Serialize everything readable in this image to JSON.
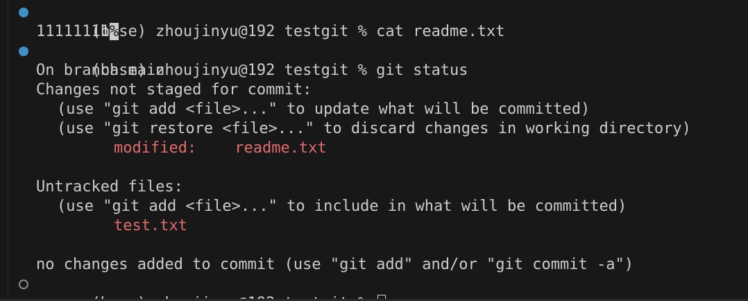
{
  "terminal": {
    "prompt": "(base) zhoujinyu@192 testgit % ",
    "commands": {
      "cat": "cat readme.txt",
      "status": "git status"
    },
    "cat_output": {
      "content": "11111111",
      "eol_marker": "%"
    },
    "status_output": {
      "branch_line": "On branch main",
      "unstaged_header": "Changes not staged for commit:",
      "unstaged_hint_1": "(use \"git add <file>...\" to update what will be committed)",
      "unstaged_hint_2": "(use \"git restore <file>...\" to discard changes in working directory)",
      "modified_label": "modified:",
      "modified_file": "readme.txt",
      "untracked_header": "Untracked files:",
      "untracked_hint": "(use \"git add <file>...\" to include in what will be committed)",
      "untracked_file": "test.txt",
      "summary": "no changes added to commit (use \"git add\" and/or \"git commit -a\")"
    },
    "colors": {
      "background": "#181818",
      "foreground": "#cccccc",
      "error_red": "#e06c6c",
      "decoration_blue": "#3f8fc8",
      "decoration_gray": "#8a8a8a"
    }
  }
}
